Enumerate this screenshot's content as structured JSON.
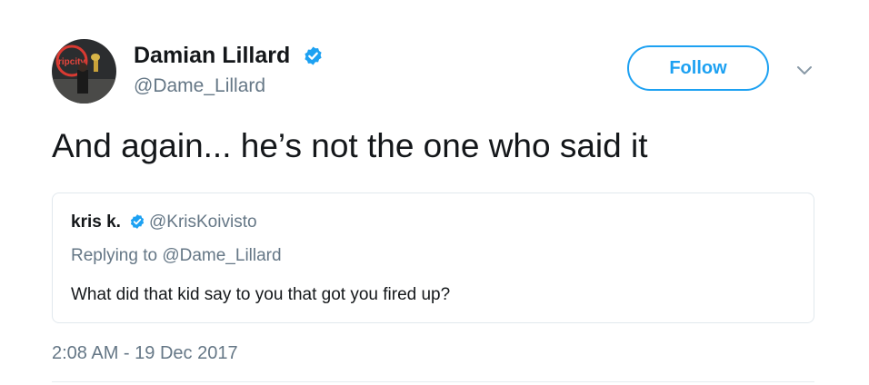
{
  "author": {
    "display_name": "Damian Lillard",
    "handle": "@Dame_Lillard",
    "verified": true,
    "avatar_icon": "profile-photo-avatar"
  },
  "actions": {
    "follow_label": "Follow",
    "menu_icon": "chevron-down-icon"
  },
  "tweet": {
    "text": "And again... he’s not the one who said it",
    "timestamp": "2:08 AM - 19 Dec 2017"
  },
  "quoted_tweet": {
    "display_name": "kris k.",
    "handle": "@KrisKoivisto",
    "verified": true,
    "replying_to": "Replying to @Dame_Lillard",
    "text": "What did that kid say to you that got you fired up?"
  },
  "colors": {
    "accent": "#1da1f2",
    "text_primary": "#14171a",
    "text_secondary": "#657786",
    "border": "#e1e8ed"
  }
}
